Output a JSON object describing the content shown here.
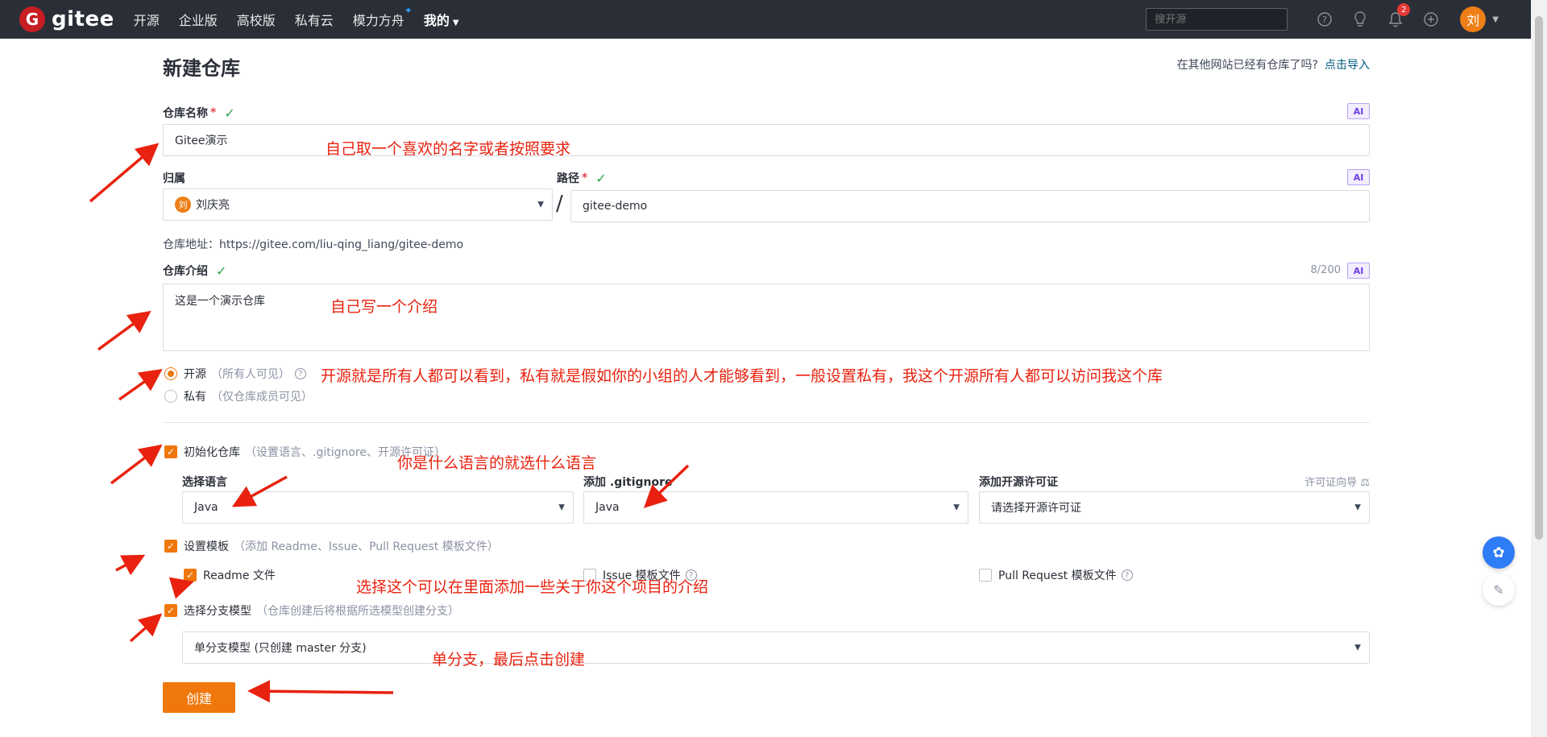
{
  "nav": {
    "logo_text": "gitee",
    "links": [
      "开源",
      "企业版",
      "高校版",
      "私有云",
      "模力方舟",
      "我的"
    ],
    "search_placeholder": "搜开源",
    "notification_count": "2",
    "avatar_text": "刘"
  },
  "page": {
    "title": "新建仓库",
    "import_hint": "在其他网站已经有仓库了吗?",
    "import_link": "点击导入"
  },
  "form": {
    "repo_name_label": "仓库名称",
    "repo_name_value": "Gitee演示",
    "ai_tag": "AI",
    "owner_label": "归属",
    "owner_avatar": "刘",
    "owner_value": "刘庆亮",
    "path_label": "路径",
    "path_value": "gitee-demo",
    "slash": "/",
    "address_text": "仓库地址：https://gitee.com/liu-qing_liang/gitee-demo",
    "intro_label": "仓库介绍",
    "intro_counter": "8/200",
    "intro_value": "这是一个演示仓库",
    "visibility": {
      "public_label": "开源",
      "public_hint": "（所有人可见）",
      "private_label": "私有",
      "private_hint": "（仅仓库成员可见）"
    },
    "init_repo": {
      "label": "初始化仓库",
      "hint": "（设置语言、.gitignore、开源许可证）",
      "language_label": "选择语言",
      "language_value": "Java",
      "gitignore_label": "添加 .gitignore",
      "gitignore_value": "Java",
      "license_label": "添加开源许可证",
      "license_guide": "许可证向导",
      "license_placeholder": "请选择开源许可证"
    },
    "template": {
      "label": "设置模板",
      "hint": "（添加 Readme、Issue、Pull Request 模板文件）",
      "readme": "Readme 文件",
      "issue": "Issue 模板文件",
      "pr": "Pull Request 模板文件"
    },
    "branch": {
      "label": "选择分支模型",
      "hint": "（仓库创建后将根据所选模型创建分支）",
      "value": "单分支模型 (只创建 master 分支)"
    },
    "create_button": "创建"
  },
  "annotations": {
    "a1": "自己取一个喜欢的名字或者按照要求",
    "a2": "自己写一个介绍",
    "a3": "开源就是所有人都可以看到，私有就是假如你的小组的人才能够看到，一般设置私有，我这个开源所有人都可以访问我这个库",
    "a4": "你是什么语言的就选什么语言",
    "a5": "选择这个可以在里面添加一些关于你这个项目的介绍",
    "a6": "单分支，最后点击创建"
  },
  "colors": {
    "accent": "#f0770b",
    "nav_bg": "#2a2e36",
    "annotation": "#e8220f",
    "link": "#005980"
  }
}
